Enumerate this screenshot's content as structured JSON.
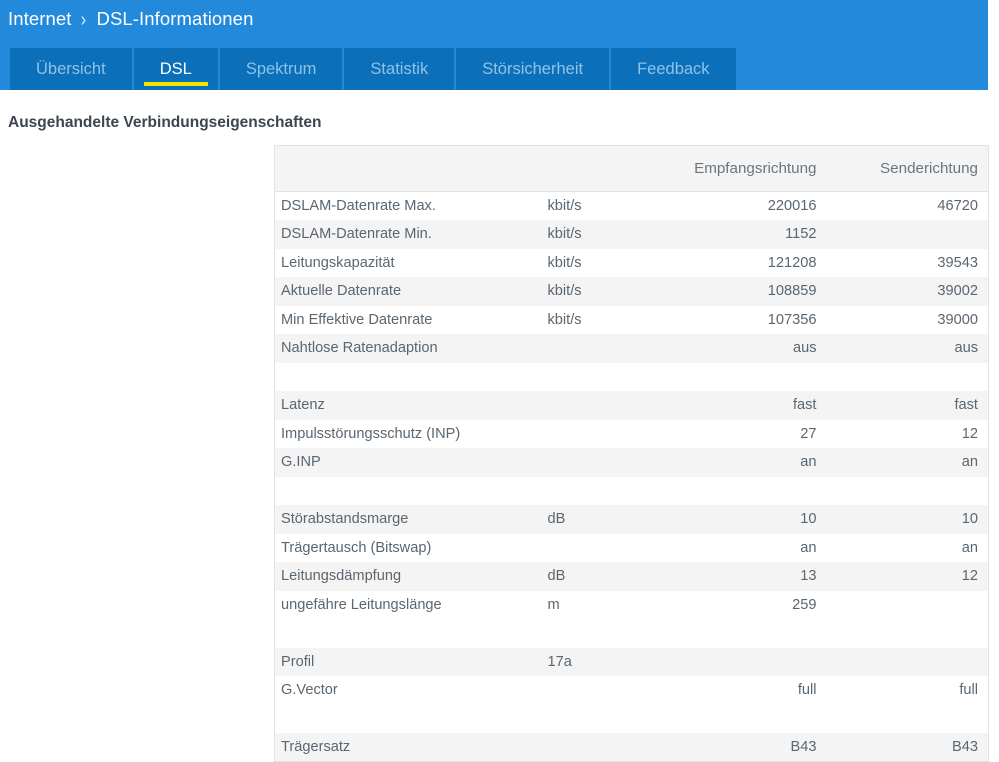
{
  "header": {
    "breadcrumb": {
      "parent": "Internet",
      "separator": "›",
      "current": "DSL-Informationen"
    },
    "band_color": "#2389da",
    "tab_color": "#0c6fba",
    "active_underline_color": "#f5e400",
    "tabs": [
      {
        "label": "Übersicht",
        "active": false
      },
      {
        "label": "DSL",
        "active": true
      },
      {
        "label": "Spektrum",
        "active": false
      },
      {
        "label": "Statistik",
        "active": false
      },
      {
        "label": "Störsicherheit",
        "active": false
      },
      {
        "label": "Feedback",
        "active": false
      }
    ]
  },
  "main": {
    "section_title": "Ausgehandelte Verbindungseigenschaften",
    "table": {
      "headers": {
        "name": "",
        "unit": "",
        "downstream": "Empfangsrichtung",
        "upstream": "Senderichtung"
      },
      "rows": [
        {
          "kind": "data",
          "name": "DSLAM-Datenrate Max.",
          "unit": "kbit/s",
          "down": "220016",
          "up": "46720"
        },
        {
          "kind": "data",
          "name": "DSLAM-Datenrate Min.",
          "unit": "kbit/s",
          "down": "1152",
          "up": ""
        },
        {
          "kind": "data",
          "name": "Leitungskapazität",
          "unit": "kbit/s",
          "down": "121208",
          "up": "39543"
        },
        {
          "kind": "data",
          "name": "Aktuelle Datenrate",
          "unit": "kbit/s",
          "down": "108859",
          "up": "39002"
        },
        {
          "kind": "data",
          "name": "Min Effektive Datenrate",
          "unit": "kbit/s",
          "down": "107356",
          "up": "39000"
        },
        {
          "kind": "data",
          "name": "Nahtlose Ratenadaption",
          "unit": "",
          "down": "aus",
          "up": "aus"
        },
        {
          "kind": "spacer",
          "name": "",
          "unit": "",
          "down": "",
          "up": ""
        },
        {
          "kind": "data",
          "name": "Latenz",
          "unit": "",
          "down": "fast",
          "up": "fast"
        },
        {
          "kind": "data",
          "name": "Impulsstörungsschutz (INP)",
          "unit": "",
          "down": "27",
          "up": "12"
        },
        {
          "kind": "data",
          "name": "G.INP",
          "unit": "",
          "down": "an",
          "up": "an"
        },
        {
          "kind": "spacer",
          "name": "",
          "unit": "",
          "down": "",
          "up": ""
        },
        {
          "kind": "data",
          "name": "Störabstandsmarge",
          "unit": "dB",
          "down": "10",
          "up": "10"
        },
        {
          "kind": "data",
          "name": "Trägertausch (Bitswap)",
          "unit": "",
          "down": "an",
          "up": "an"
        },
        {
          "kind": "data",
          "name": "Leitungsdämpfung",
          "unit": "dB",
          "down": "13",
          "up": "12"
        },
        {
          "kind": "data",
          "name": "ungefähre Leitungslänge",
          "unit": "m",
          "down": "259",
          "up": ""
        },
        {
          "kind": "spacer",
          "name": "",
          "unit": "",
          "down": "",
          "up": ""
        },
        {
          "kind": "data",
          "name": "Profil",
          "unit": "17a",
          "down": "",
          "up": ""
        },
        {
          "kind": "data",
          "name": "G.Vector",
          "unit": "",
          "down": "full",
          "up": "full"
        },
        {
          "kind": "spacer",
          "name": "",
          "unit": "",
          "down": "",
          "up": ""
        },
        {
          "kind": "data",
          "name": "Trägersatz",
          "unit": "",
          "down": "B43",
          "up": "B43"
        }
      ]
    }
  }
}
